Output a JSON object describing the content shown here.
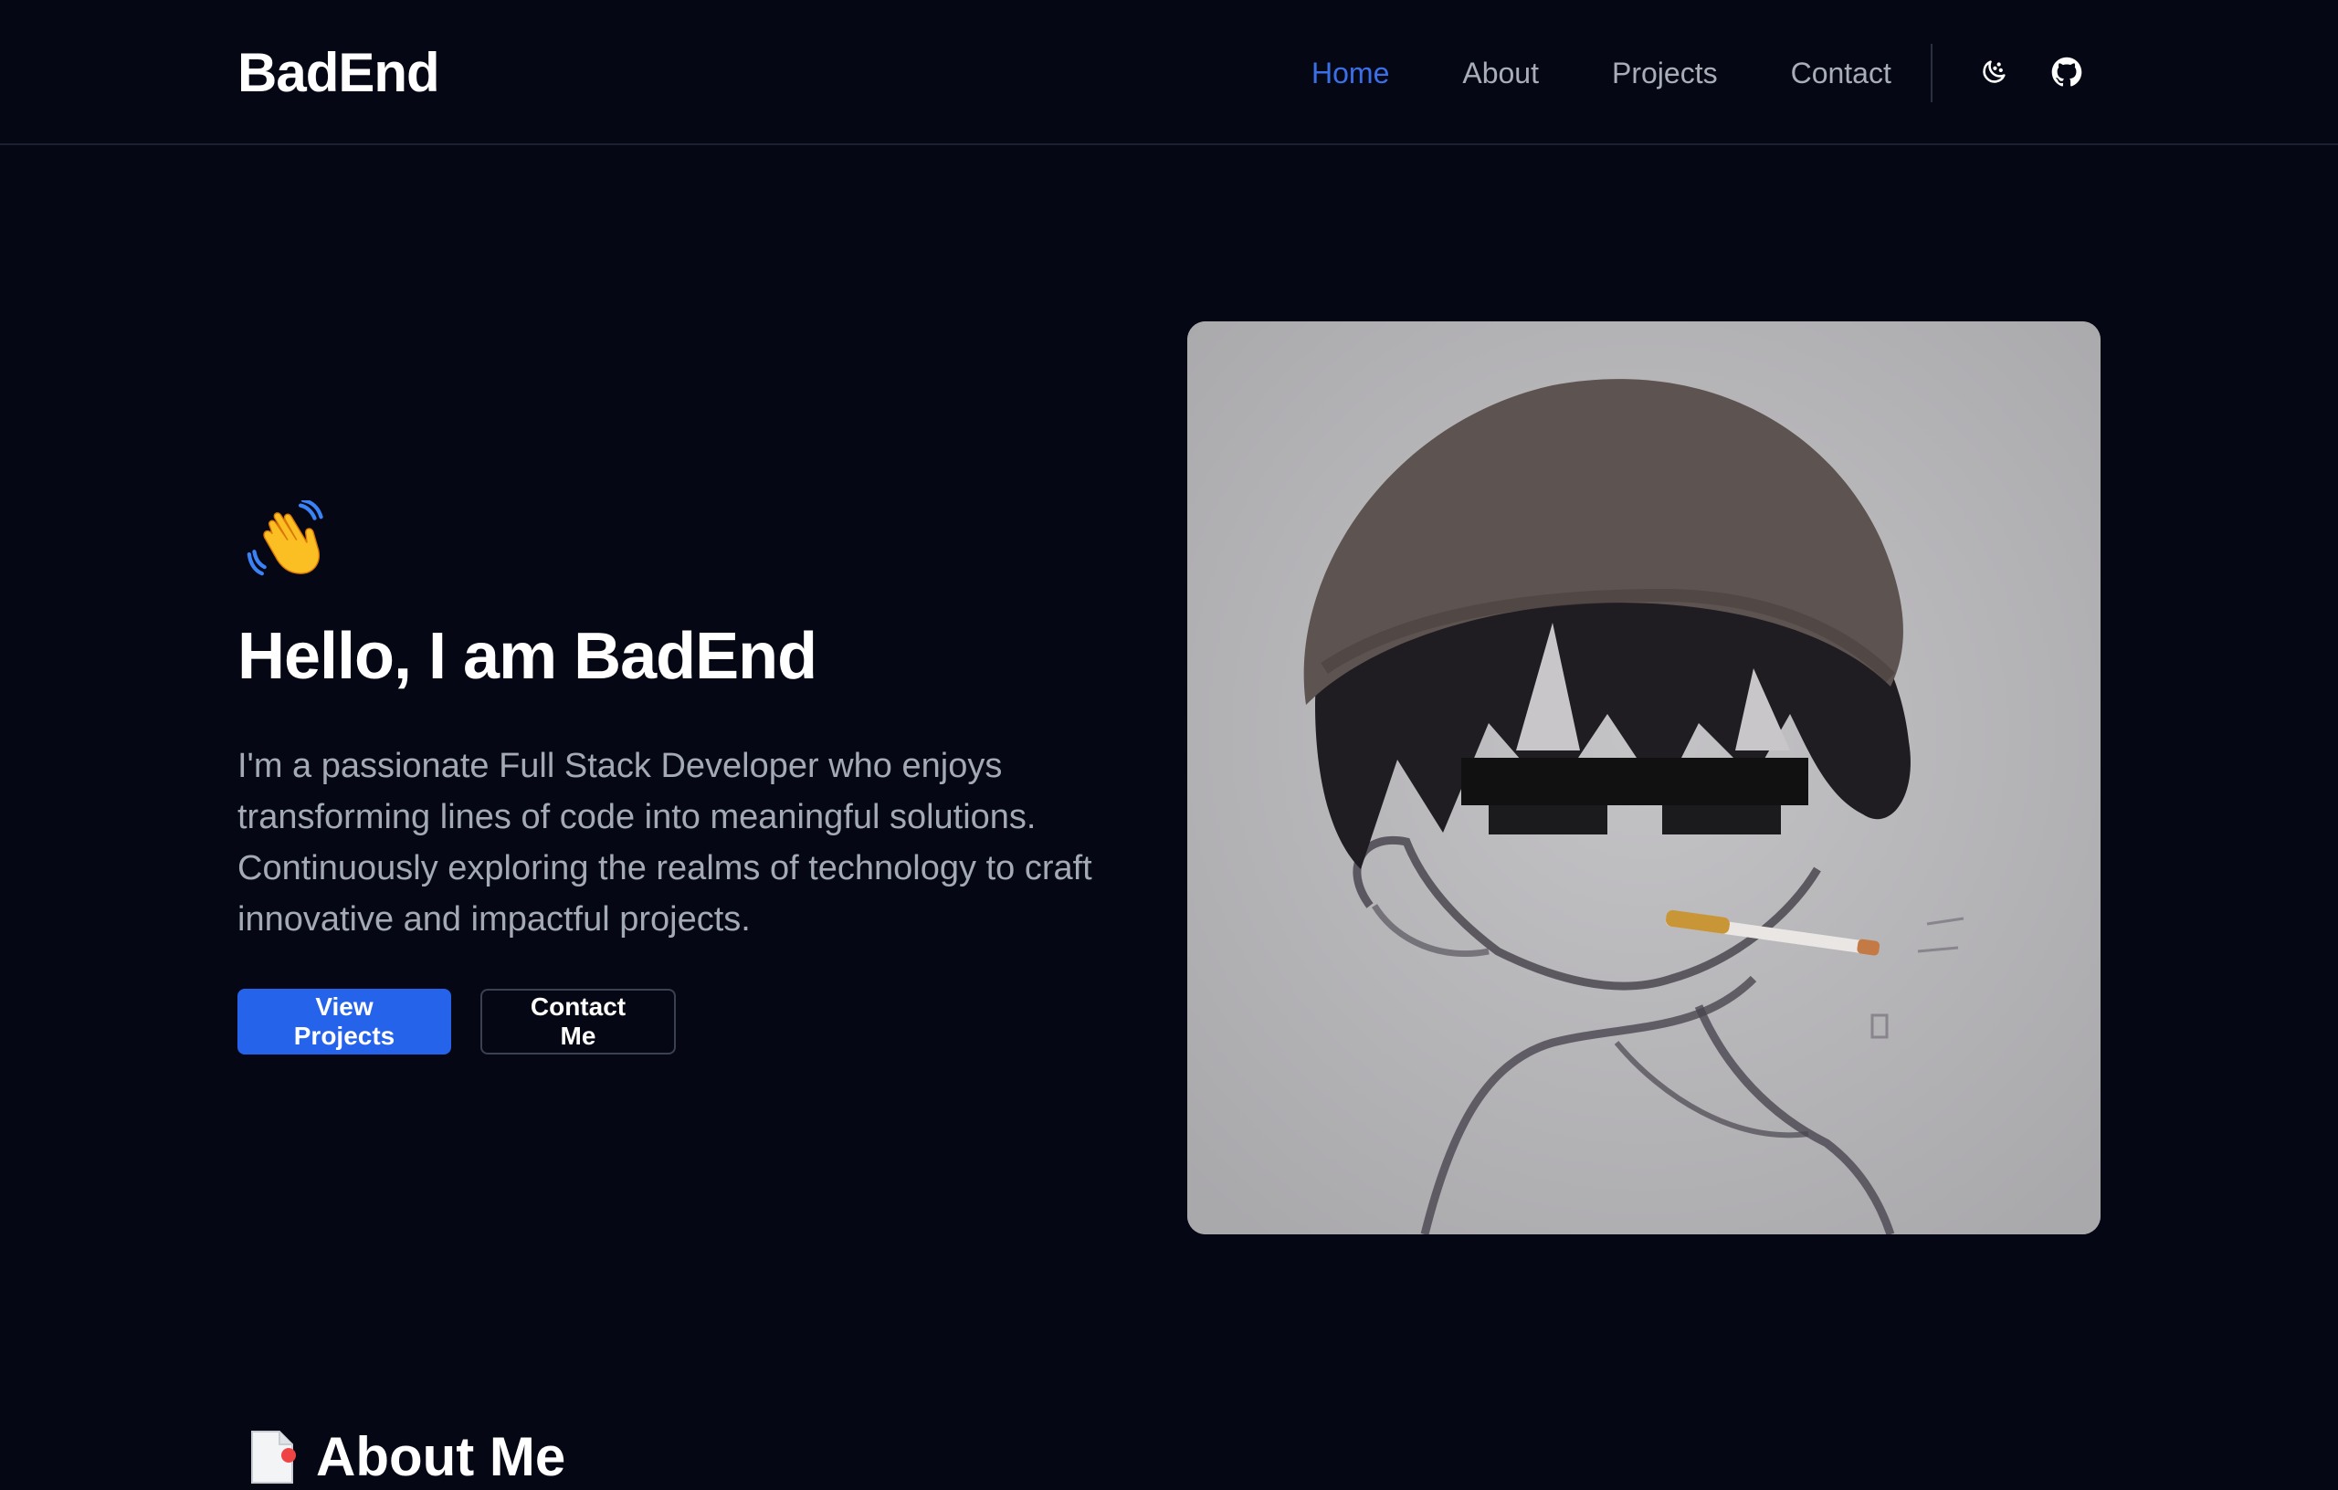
{
  "header": {
    "logo": "BadEnd",
    "nav": [
      {
        "label": "Home",
        "active": true
      },
      {
        "label": "About",
        "active": false
      },
      {
        "label": "Projects",
        "active": false
      },
      {
        "label": "Contact",
        "active": false
      }
    ],
    "icons": [
      "theme-toggle-icon",
      "github-icon"
    ]
  },
  "hero": {
    "emoji": "waving-hand-icon",
    "title": "Hello, I am BadEnd",
    "description": "I'm a passionate Full Stack Developer who enjoys transforming lines of code into meaningful solutions. Continuously exploring the realms of technology to craft innovative and impactful projects.",
    "primary_button": "View Projects",
    "secondary_button": "Contact Me"
  },
  "about": {
    "title": "About Me",
    "icon": "document-icon"
  },
  "colors": {
    "background": "#050814",
    "accent": "#2563eb",
    "nav_active": "#3b6fe8",
    "muted_text": "#a3a9b5"
  }
}
